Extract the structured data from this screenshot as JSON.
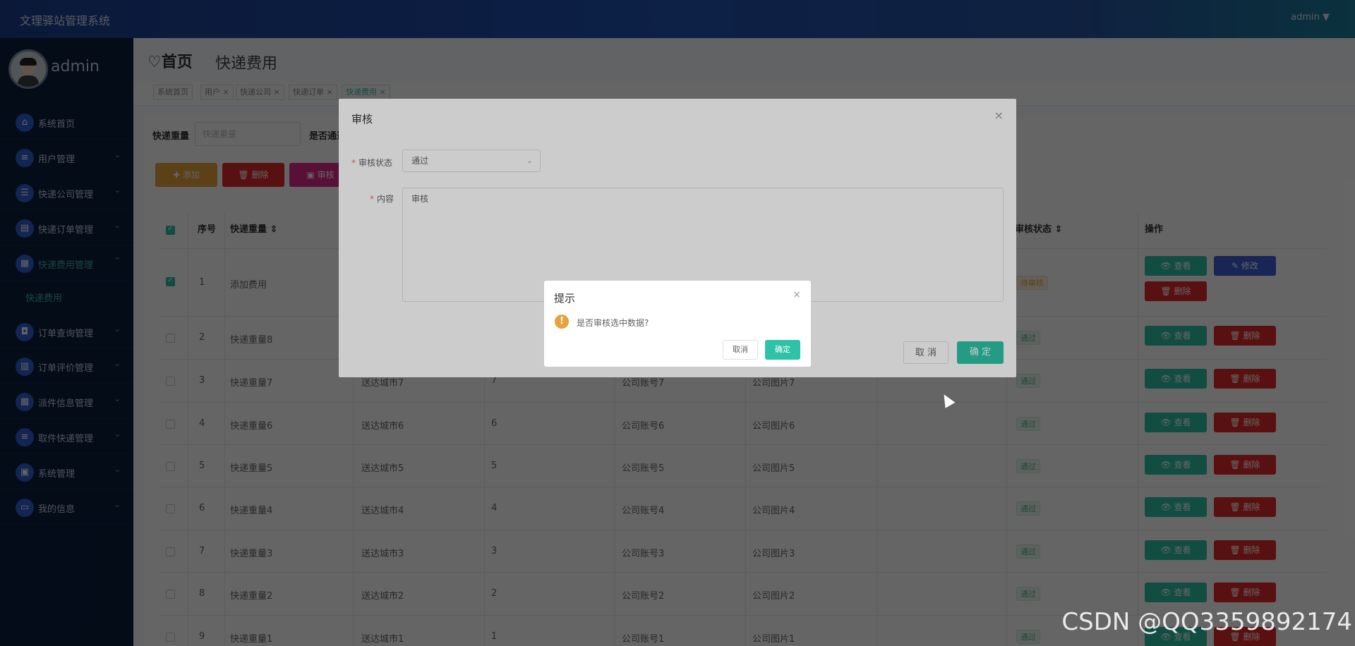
{
  "app": {
    "title": "文理驿站管理系统",
    "user": "admin ▼"
  },
  "sidebar": {
    "username": "admin",
    "items": [
      {
        "label": "系统首页",
        "icon": "home-icon",
        "arrow": ""
      },
      {
        "label": "用户管理",
        "icon": "list-icon",
        "arrow": "⌄"
      },
      {
        "label": "快递公司管理",
        "icon": "sliders-icon",
        "arrow": "⌄"
      },
      {
        "label": "快递订单管理",
        "icon": "clipboard-icon",
        "arrow": "⌄"
      },
      {
        "label": "快递费用管理",
        "icon": "grid-icon",
        "arrow": "⌃"
      },
      {
        "label": "订单查询管理",
        "icon": "bag-icon",
        "arrow": "⌄"
      },
      {
        "label": "订单评价管理",
        "icon": "chart-icon",
        "arrow": "⌄"
      },
      {
        "label": "派件信息管理",
        "icon": "apps-icon",
        "arrow": "⌄"
      },
      {
        "label": "取件快递管理",
        "icon": "menu-icon",
        "arrow": "⌄"
      },
      {
        "label": "系统管理",
        "icon": "doc-icon",
        "arrow": "⌄"
      },
      {
        "label": "我的信息",
        "icon": "card-icon",
        "arrow": "⌄"
      }
    ],
    "subitem": "快递费用"
  },
  "header": {
    "home": "♡首页",
    "current": "快递费用"
  },
  "tags": [
    "系统首页",
    "用户 ×",
    "快递公司 ×",
    "快递订单 ×",
    "快递费用 ×"
  ],
  "search": {
    "label1": "快递重量",
    "placeholder1": "快递重量",
    "label2": "是否通过"
  },
  "toolbar": {
    "add": "✚ 添加",
    "delete": "🗑 删除",
    "audit": "▣ 审核"
  },
  "table": {
    "headers": {
      "index": "序号",
      "weight": "快递重量 ⇕",
      "audit": "审核状态 ⇕",
      "ops": "操作"
    },
    "rows": [
      {
        "i": "1",
        "w": "添加费用",
        "city": "",
        "n": "",
        "acct": "",
        "img": "",
        "status": "待审核"
      },
      {
        "i": "2",
        "w": "快递重量8",
        "city": "",
        "n": "",
        "acct": "",
        "img": "",
        "status": "通过"
      },
      {
        "i": "3",
        "w": "快递重量7",
        "city": "送达城市7",
        "n": "7",
        "acct": "公司账号7",
        "img": "公司图片7",
        "status": "通过"
      },
      {
        "i": "4",
        "w": "快递重量6",
        "city": "送达城市6",
        "n": "6",
        "acct": "公司账号6",
        "img": "公司图片6",
        "status": "通过"
      },
      {
        "i": "5",
        "w": "快递重量5",
        "city": "送达城市5",
        "n": "5",
        "acct": "公司账号5",
        "img": "公司图片5",
        "status": "通过"
      },
      {
        "i": "6",
        "w": "快递重量4",
        "city": "送达城市4",
        "n": "4",
        "acct": "公司账号4",
        "img": "公司图片4",
        "status": "通过"
      },
      {
        "i": "7",
        "w": "快递重量3",
        "city": "送达城市3",
        "n": "3",
        "acct": "公司账号3",
        "img": "公司图片3",
        "status": "通过"
      },
      {
        "i": "8",
        "w": "快递重量2",
        "city": "送达城市2",
        "n": "2",
        "acct": "公司账号2",
        "img": "公司图片2",
        "status": "通过"
      },
      {
        "i": "9",
        "w": "快递重量1",
        "city": "送达城市1",
        "n": "1",
        "acct": "公司账号1",
        "img": "公司图片1",
        "status": "通过"
      }
    ],
    "actions": {
      "view": "👁 查看",
      "edit": "✎ 修改",
      "delete": "🗑 删除"
    }
  },
  "dialog": {
    "title": "审核",
    "close": "×",
    "status_label": "审核状态",
    "status_value": "通过",
    "content_label": "内容",
    "content_value": "审核",
    "cancel": "取 消",
    "confirm": "确 定"
  },
  "msgbox": {
    "title": "提示",
    "close": "×",
    "icon": "!",
    "text": "是否审核选中数据?",
    "cancel": "取消",
    "confirm": "确定"
  },
  "watermark": "CSDN @QQ3359892174"
}
